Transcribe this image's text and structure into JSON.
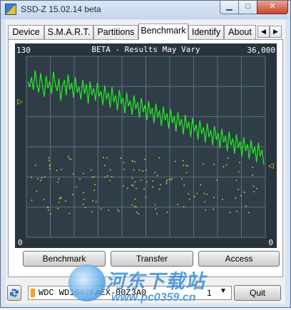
{
  "window": {
    "title": "SSD-Z 15.02.14 beta",
    "buttons": {
      "minimize": "▁",
      "maximize": "□",
      "close": "✕"
    }
  },
  "tabs": [
    {
      "label": "Device",
      "active": false
    },
    {
      "label": "S.M.A.R.T.",
      "active": false
    },
    {
      "label": "Partitions",
      "active": false
    },
    {
      "label": "Benchmark",
      "active": true
    },
    {
      "label": "Identify",
      "active": false
    },
    {
      "label": "About",
      "active": false
    }
  ],
  "tab_scroll": {
    "left": "◀",
    "right": "▶"
  },
  "chart_data": {
    "type": "line",
    "title": "BETA - Results May Vary",
    "y_left_max": "130",
    "y_left_min": "0",
    "y_right_max": "36,000",
    "y_right_min": "0",
    "ylim_left": [
      0,
      130
    ],
    "ylim_right": [
      0,
      36000
    ],
    "grid": true,
    "background": "#2f3d47",
    "grid_color": "#5d7180",
    "line_color": "#22ee22",
    "dots_color": "#e6e62e",
    "left_marker": "▷",
    "right_marker": "◁",
    "left_marker_value": 98,
    "right_marker_value": 52,
    "series": [
      {
        "values": [
          112,
          108,
          115,
          106,
          120,
          110,
          104,
          118,
          109,
          101,
          116,
          107,
          112,
          103,
          119,
          110,
          105,
          114,
          98,
          109,
          113,
          102,
          117,
          106,
          111,
          100,
          115,
          104,
          108,
          99,
          113,
          103,
          110,
          96,
          112,
          102,
          107,
          98,
          111,
          101,
          105,
          95,
          109,
          99,
          104,
          93,
          108,
          97,
          102,
          91,
          106,
          96,
          100,
          89,
          104,
          94,
          98,
          88,
          102,
          92,
          97,
          86,
          100,
          90,
          95,
          84,
          98,
          88,
          93,
          82,
          96,
          86,
          91,
          80,
          94,
          84,
          89,
          78,
          92,
          82,
          87,
          76,
          90,
          80,
          85,
          74,
          88,
          78,
          83,
          72,
          86,
          76,
          81,
          70,
          84,
          74,
          79,
          68,
          82,
          72,
          77,
          66,
          80,
          70,
          75,
          64,
          78,
          68,
          73,
          62,
          76,
          66,
          71,
          60,
          74,
          64,
          69,
          58,
          72,
          62,
          67,
          56,
          70,
          60,
          65,
          54,
          68,
          58,
          63,
          52
        ]
      }
    ],
    "scatter_fraction_points": 150
  },
  "buttons": {
    "benchmark": "Benchmark",
    "transfer": "Transfer",
    "access": "Access",
    "quit": "Quit"
  },
  "drive": {
    "name": "WDC WD1002FAEX-00Z3A0",
    "index": "1",
    "accent": "#f0a31c"
  },
  "watermark": {
    "title": "河东下载站",
    "url": "www.pc0359.cn"
  }
}
